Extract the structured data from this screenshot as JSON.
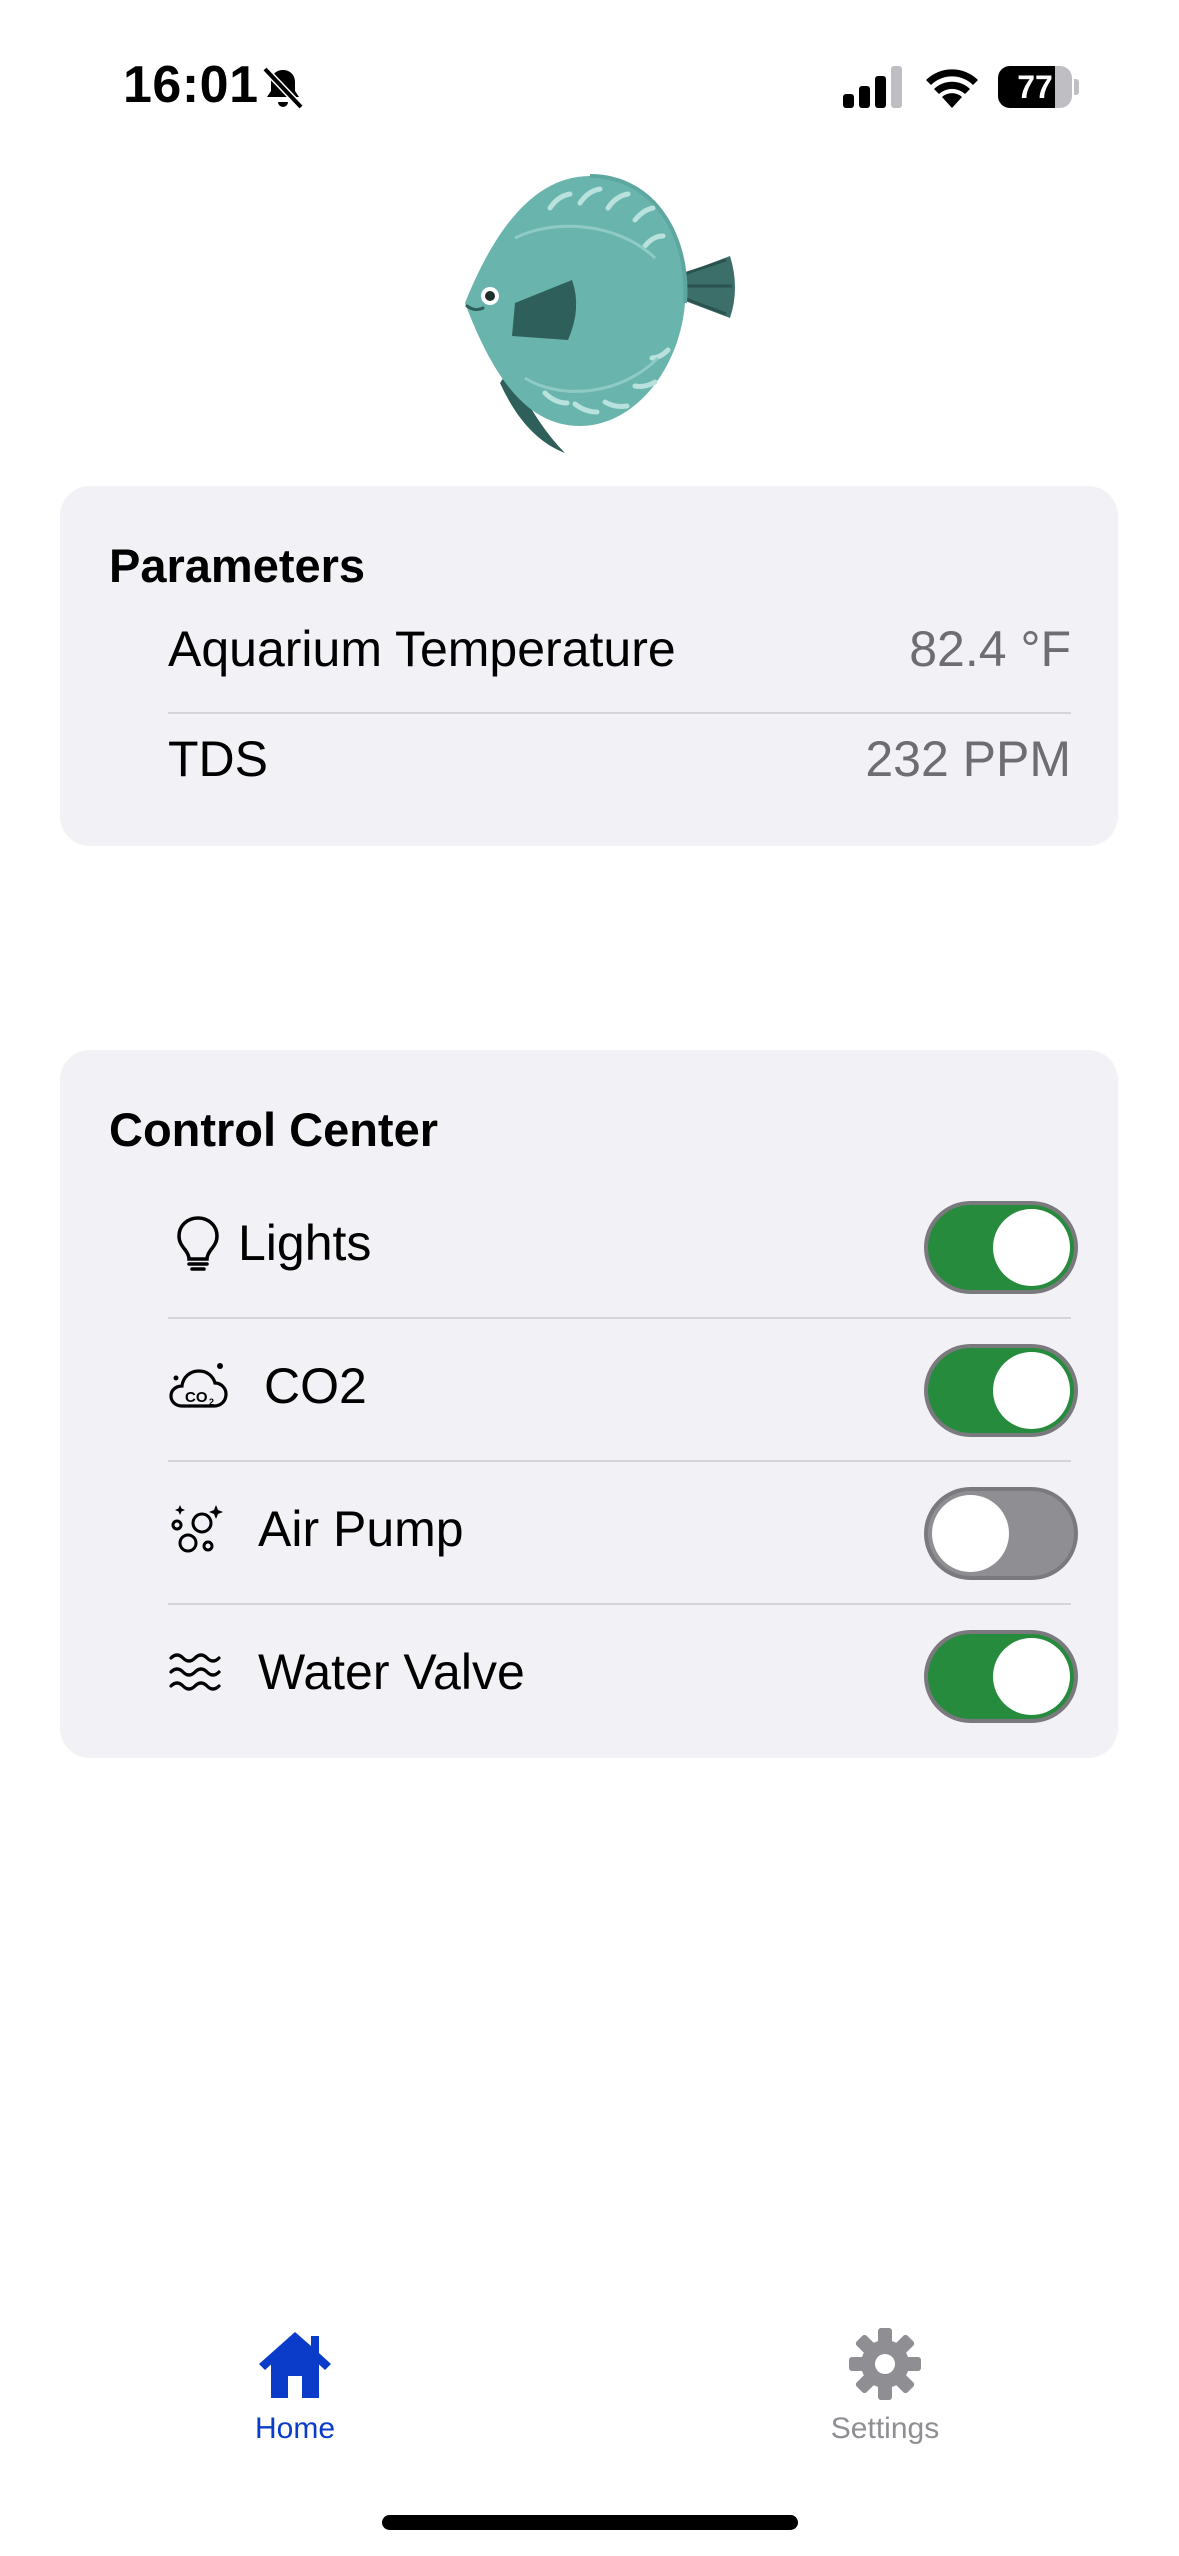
{
  "status_bar": {
    "time": "16:01",
    "battery_level": "77",
    "battery_percent": 0.77,
    "icons": [
      "bell-slash-icon",
      "cellular-signal-icon",
      "wifi-icon",
      "battery-icon"
    ]
  },
  "logo": {
    "icon": "discus-fish-icon"
  },
  "parameters": {
    "title": "Parameters",
    "rows": [
      {
        "label": "Aquarium Temperature",
        "value": "82.4 °F"
      },
      {
        "label": "TDS",
        "value": "232 PPM"
      }
    ]
  },
  "control_center": {
    "title": "Control Center",
    "items": [
      {
        "label": "Lights",
        "icon": "lightbulb-icon",
        "on": true
      },
      {
        "label": "CO2",
        "icon": "co2-cloud-icon",
        "on": true
      },
      {
        "label": "Air Pump",
        "icon": "bubbles-icon",
        "on": false
      },
      {
        "label": "Water Valve",
        "icon": "water-waves-icon",
        "on": true
      }
    ]
  },
  "tab_bar": {
    "tabs": [
      {
        "label": "Home",
        "icon": "house-icon",
        "selected": true
      },
      {
        "label": "Settings",
        "icon": "gear-icon",
        "selected": false
      }
    ]
  },
  "colors": {
    "accent_tab": "#0a3cc9",
    "toggle_on": "#268b3c",
    "toggle_off": "#8e8e93",
    "card_bg": "#f2f2f6",
    "fish_body": "#6ab4ae",
    "fish_fin": "#2f5f5b"
  }
}
